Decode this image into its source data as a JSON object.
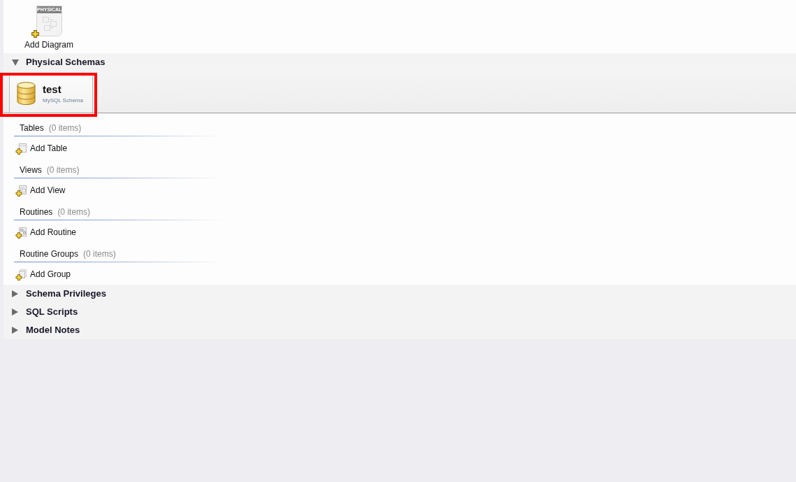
{
  "diagrams": {
    "items": [
      {
        "label": "Add Diagram",
        "icon_caption": "PHYSICAL"
      }
    ]
  },
  "sections": [
    {
      "title": "Physical Schemas",
      "expanded": true,
      "schemas": [
        {
          "name": "test",
          "subtitle": "MySQL Schema",
          "selected": true,
          "highlighted": true
        }
      ],
      "groups": [
        {
          "kind": "table",
          "title": "Tables",
          "count": "(0 items)",
          "add_label": "Add Table"
        },
        {
          "kind": "view",
          "title": "Views",
          "count": "(0 items)",
          "add_label": "Add View"
        },
        {
          "kind": "routine",
          "title": "Routines",
          "count": "(0 items)",
          "add_label": "Add Routine"
        },
        {
          "kind": "group",
          "title": "Routine Groups",
          "count": "(0 items)",
          "add_label": "Add Group"
        }
      ]
    },
    {
      "title": "Schema Privileges",
      "expanded": false
    },
    {
      "title": "SQL Scripts",
      "expanded": false
    },
    {
      "title": "Model Notes",
      "expanded": false
    }
  ]
}
